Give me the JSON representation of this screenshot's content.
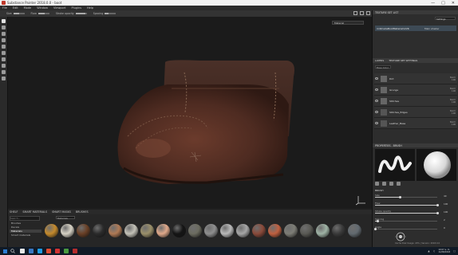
{
  "window": {
    "title": "Substance Painter 2018.0.0 - boot"
  },
  "menu": [
    "File",
    "Edit",
    "Mode",
    "Window",
    "Viewport",
    "Plugins",
    "Help"
  ],
  "tool_options": [
    {
      "label": "Size",
      "fill": 0.5
    },
    {
      "label": "Flow",
      "fill": 0.6
    },
    {
      "label": "Stroke opacity",
      "fill": 0.9
    },
    {
      "label": "Spacing",
      "fill": 0.3
    }
  ],
  "viewport": {
    "mode_label": "Material"
  },
  "shelf": {
    "tabs": [
      "SHELF",
      "SMART MATERIALS",
      "SMART MASKS",
      "BRUSHES"
    ],
    "search_placeholder": "Search...",
    "categories": [
      "Brushes",
      "Decals",
      "Materials",
      "Smart materials"
    ],
    "selected_category": "Materials",
    "filter_label": "Materials",
    "material_colors": [
      "#c58a2c",
      "#d7d2c5",
      "#6a4026",
      "#2b2b2b",
      "#b07a55",
      "#c4c2b8",
      "#9a8f6a",
      "#e0a98a",
      "#151515",
      "#6c6c60",
      "#8f8f8f",
      "#b9b9b9",
      "#a6a6a6",
      "#8a4a3a",
      "#c06040",
      "#7d7d76",
      "#5a5a55",
      "#9fb3a5",
      "#3a3a3a",
      "#626a70"
    ]
  },
  "texture_set": {
    "header": "TEXTURE SET LIST",
    "settings_label": "Settings",
    "name": "millmadeBootMaterial1226",
    "shader": "Main shader"
  },
  "layers": {
    "tabs": [
      "LAYERS",
      "TEXTURE SET SETTINGS"
    ],
    "blend_mode": "Base Color",
    "items": [
      {
        "name": "Dirt",
        "blend": "Norm",
        "opacity": "100"
      },
      {
        "name": "Grunge",
        "blend": "Norm",
        "opacity": "100"
      },
      {
        "name": "Stitches",
        "blend": "Norm",
        "opacity": "100"
      },
      {
        "name": "Stitches_Edges",
        "blend": "Norm",
        "opacity": "100"
      },
      {
        "name": "Leather_Base",
        "blend": "Norm",
        "opacity": "100"
      }
    ]
  },
  "properties": {
    "header": "PROPERTIES - BRUSH",
    "section": "BRUSH",
    "params": [
      {
        "name": "Size",
        "value": "40",
        "fill": 0.4
      },
      {
        "name": "Flow",
        "value": "100",
        "fill": 1.0
      },
      {
        "name": "Stroke opacity",
        "value": "100",
        "fill": 1.0
      },
      {
        "name": "Spacing",
        "value": "2",
        "fill": 0.05
      },
      {
        "name": "Angle",
        "value": "0",
        "fill": 0.0
      }
    ]
  },
  "status_text": "Cache Disk Usage: 20% | Version: 2018.0.0",
  "taskbar": {
    "time": "10:07 a. m.",
    "date": "11/08/2018",
    "apps": [
      "#e8e8e8",
      "#3a78c2",
      "#1e9be3",
      "#e04a2f",
      "#d13232",
      "#4a9a40",
      "#b52d2d"
    ]
  }
}
